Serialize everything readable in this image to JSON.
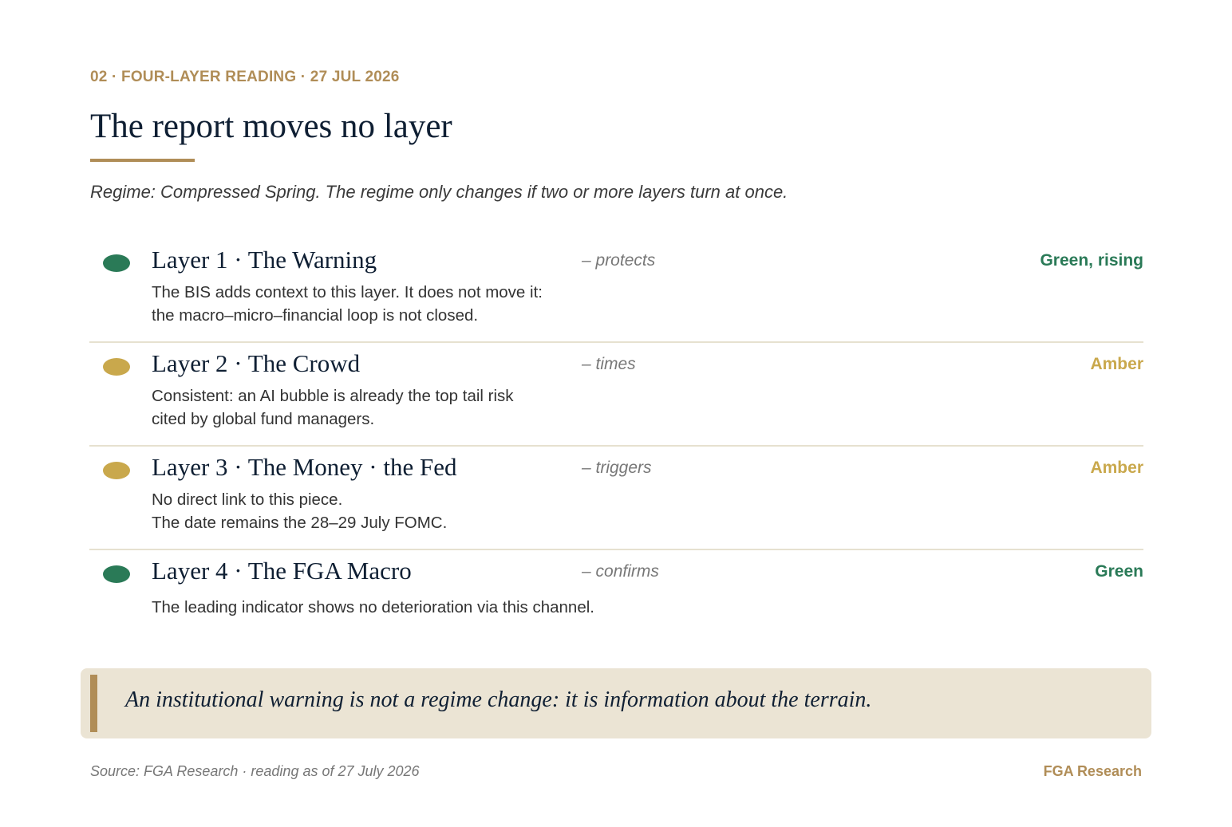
{
  "header": {
    "eyebrow": "02 · FOUR-LAYER READING · 27 JUL 2026",
    "title": "The report moves no layer",
    "subtitle": "Regime: Compressed Spring. The regime only changes if two or more layers turn at once."
  },
  "colors": {
    "accent": "#b08d57",
    "green": "#2a7a57",
    "amber": "#c9a84c",
    "navy": "#0f1f33",
    "quote_bg": "#ebe4d4"
  },
  "layers": [
    {
      "name": "Layer 1 · The Warning",
      "role": "– protects",
      "status": "Green, rising",
      "status_color": "#2a7a57",
      "dot_color": "#2a7a57",
      "description": [
        "The BIS adds context to this layer. It does not move it:",
        "the macro–micro–financial loop is not closed."
      ]
    },
    {
      "name": "Layer 2 · The Crowd",
      "role": "– times",
      "status": "Amber",
      "status_color": "#c9a84c",
      "dot_color": "#c9a84c",
      "description": [
        "Consistent: an AI bubble is already the top tail risk",
        "cited by global fund managers."
      ]
    },
    {
      "name": "Layer 3 · The Money · the Fed",
      "role": "– triggers",
      "status": "Amber",
      "status_color": "#c9a84c",
      "dot_color": "#c9a84c",
      "description": [
        "No direct link to this piece.",
        "The date remains the 28–29 July FOMC."
      ]
    },
    {
      "name": "Layer 4 · The FGA Macro",
      "role": "– confirms",
      "status": "Green",
      "status_color": "#2a7a57",
      "dot_color": "#2a7a57",
      "description": [
        "",
        "The leading indicator shows no deterioration via this channel."
      ]
    }
  ],
  "quote": {
    "text": "An institutional warning is not a regime change: it is information about the terrain."
  },
  "footer": {
    "source": "Source: FGA Research · reading as of 27 July 2026",
    "brand": "FGA Research"
  }
}
